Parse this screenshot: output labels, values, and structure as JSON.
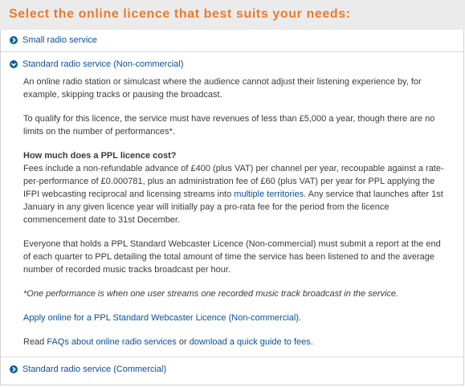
{
  "heading": "Select the online licence that best suits your needs:",
  "accordion": {
    "small": {
      "label": "Small radio service",
      "icon": "chevron-right-icon"
    },
    "standard_nc": {
      "label": "Standard radio service (Non-commercial)",
      "icon": "chevron-down-icon",
      "para1": "An online radio station or simulcast where the audience cannot adjust their listening experience by, for example, skipping tracks or pausing the broadcast.",
      "para2": "To qualify for this licence, the service must have revenues of less than £5,000 a year, though there are no limits on the number of performances*.",
      "cost_heading": "How much does a PPL licence cost?",
      "cost_text_before": "Fees include a non-refundable advance of £400 (plus VAT) per channel per year, recoupable against a rate-per-performance of £0.000781, plus an administration fee of £60 (plus VAT) per year for PPL applying the IFPI webcasting reciprocal and licensing streams into ",
      "cost_link": "multiple territories",
      "cost_text_after": ". Any service that launches after 1st January in any given licence year will initially pay a pro-rata fee for the period from the licence commencement date to 31st December.",
      "para_report": "Everyone that holds a PPL Standard Webcaster Licence (Non-commercial) must submit a report at the end of each quarter to PPL detailing the total amount of time the service has been listened to and the average number of recorded music tracks broadcast per hour.",
      "footnote": "*One performance is when one user streams one recorded music track broadcast in the service.",
      "apply_link": "Apply online for a PPL Standard Webcaster Licence (Non-commercial).",
      "read_prefix": "Read ",
      "faq_link": "FAQs about online radio services",
      "read_or": " or ",
      "guide_link": "download a quick guide to fees",
      "read_suffix": "."
    },
    "standard_c": {
      "label": "Standard radio service (Commercial)",
      "icon": "chevron-right-icon"
    }
  },
  "colors": {
    "heading": "#ec7a2a",
    "link": "#0b4f96",
    "icon": "#0b5fa8",
    "heading_bg": "#ebebeb"
  }
}
